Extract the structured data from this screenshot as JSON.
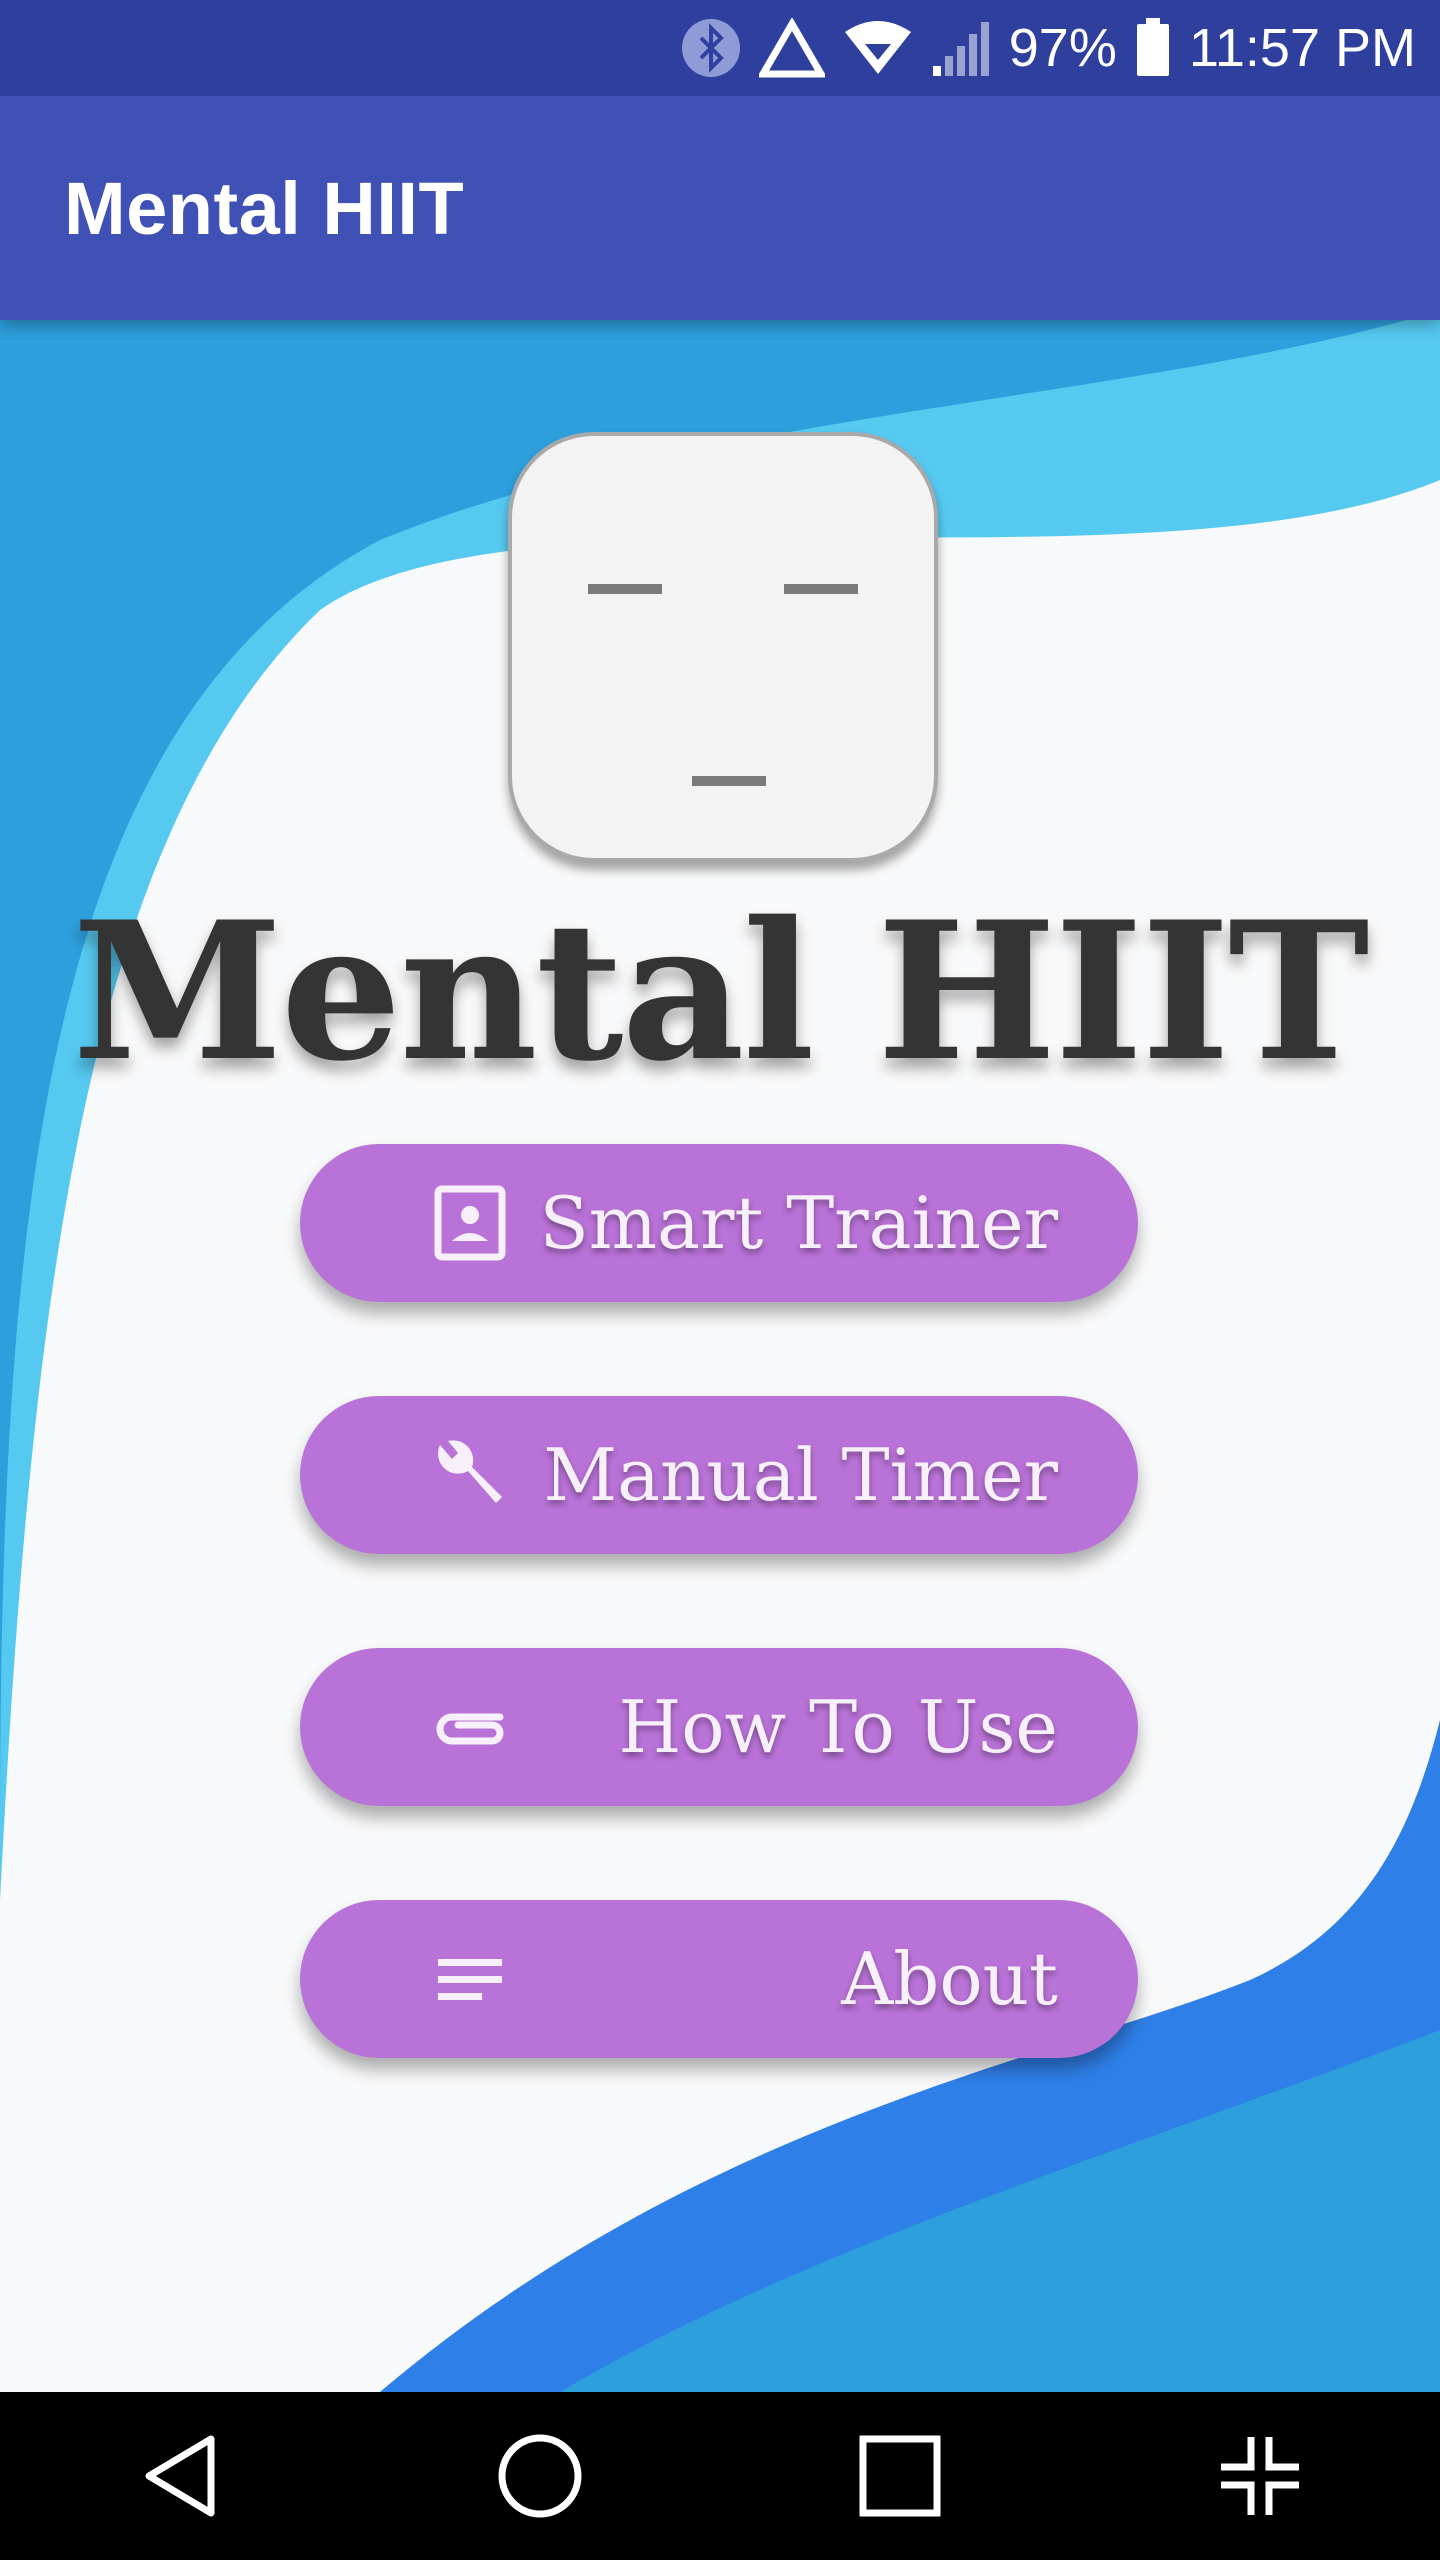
{
  "status_bar": {
    "icons": [
      "bluetooth-icon",
      "no-data-triangle-icon",
      "wifi-icon",
      "cell-signal-icon",
      "battery-icon"
    ],
    "battery": "97%",
    "time": "11:57 PM"
  },
  "app_bar": {
    "title": "Mental HIIT"
  },
  "main": {
    "logo_icon": "face-neutral-icon",
    "title": "Mental HIIT",
    "buttons": [
      {
        "label": "Smart Trainer",
        "icon": "contact-portrait-icon"
      },
      {
        "label": "Manual Timer",
        "icon": "wrench-icon"
      },
      {
        "label": "How To Use",
        "icon": "paperclip-icon"
      },
      {
        "label": "About",
        "icon": "subject-lines-icon"
      }
    ]
  },
  "nav_bar": {
    "icons": [
      "back-icon",
      "home-icon",
      "recents-icon",
      "exit-fullscreen-icon"
    ]
  },
  "colors": {
    "status_bar": "#2f3f9e",
    "app_bar": "#3f51b5",
    "button": "#b972d7",
    "wave_blue": "#2d9fdc",
    "wave_light_blue": "#56c9f0",
    "wave_bottom_blue": "#2f7fe8",
    "surface": "#f8f9fa"
  }
}
